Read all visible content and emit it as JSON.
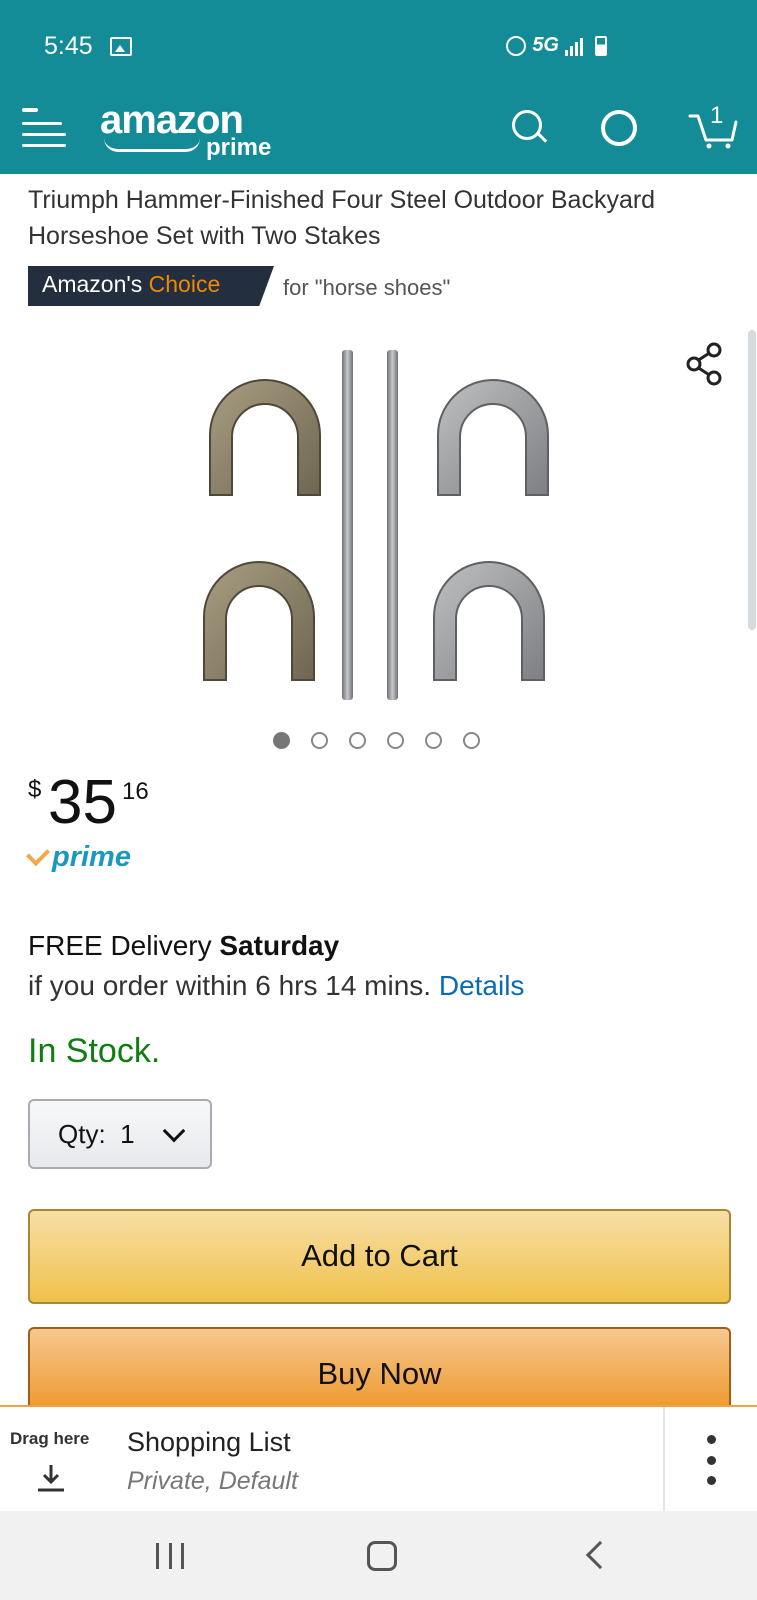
{
  "status_bar": {
    "time": "5:45",
    "network": "5G",
    "icons": [
      "gallery-icon",
      "alarm-icon",
      "signal-icon",
      "battery-icon"
    ]
  },
  "header": {
    "logo_main": "amazon",
    "logo_sub": "prime",
    "cart_count": "1",
    "accent_color": "#138c97"
  },
  "product": {
    "title": "Triumph Hammer-Finished Four Steel Outdoor Backyard Horseshoe Set with Two Stakes",
    "badge_prefix": "Amazon's",
    "badge_choice": "Choice",
    "badge_query": "for \"horse shoes\""
  },
  "gallery": {
    "image_count": 6,
    "active_index": 0
  },
  "price": {
    "symbol": "$",
    "whole": "35",
    "fraction": "16",
    "prime_label": "prime"
  },
  "delivery": {
    "prefix": "FREE Delivery ",
    "day": "Saturday",
    "condition": "if you order within 6 hrs 14 mins. ",
    "details_link": "Details"
  },
  "stock": {
    "status": "In Stock.",
    "color": "#107d10"
  },
  "quantity": {
    "label": "Qty:",
    "value": "1"
  },
  "actions": {
    "add_to_cart": "Add to Cart",
    "buy_now": "Buy Now"
  },
  "drag_panel": {
    "drag_label": "Drag here",
    "list_title": "Shopping List",
    "list_subtitle": "Private, Default"
  }
}
